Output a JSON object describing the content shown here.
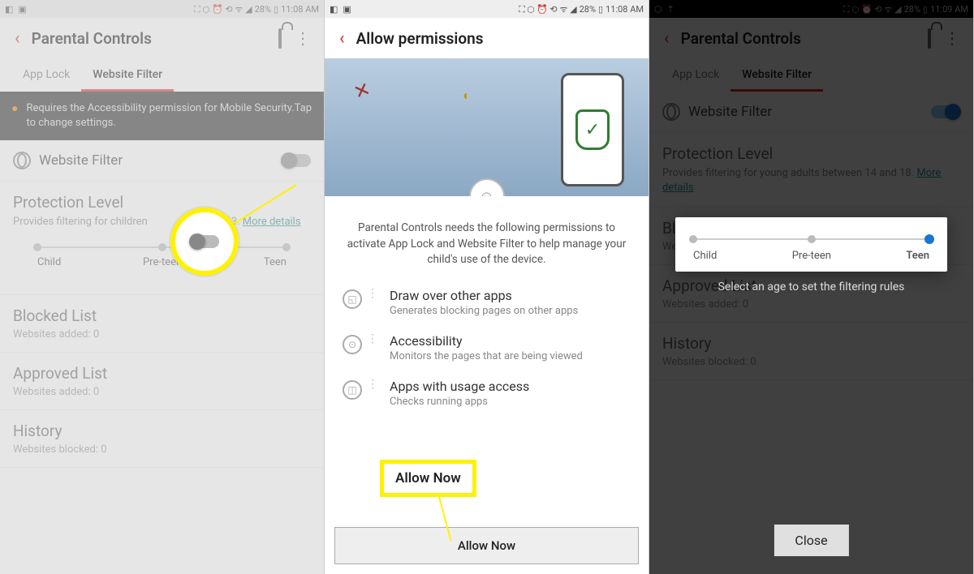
{
  "status": {
    "battery": "28%",
    "time1": "11:08 AM",
    "time2": "11:08 AM",
    "time3": "11:09 AM"
  },
  "s1": {
    "title": "Parental Controls",
    "tabs": {
      "appLock": "App Lock",
      "websiteFilter": "Website Filter"
    },
    "banner": "Requires the Accessibility permission for Mobile Security.Tap to change settings.",
    "websiteFilterLabel": "Website Filter",
    "protection": {
      "title": "Protection Level",
      "desc_a": "Provides filtering for children",
      "desc_b": "and 13.",
      "more": "More details"
    },
    "levels": {
      "child": "Child",
      "preteen": "Pre-teen",
      "teen": "Teen"
    },
    "blocked": {
      "title": "Blocked List",
      "sub": "Websites added: 0"
    },
    "approved": {
      "title": "Approved List",
      "sub": "Websites added: 0"
    },
    "history": {
      "title": "History",
      "sub": "Websites blocked: 0"
    }
  },
  "s2": {
    "title": "Allow permissions",
    "desc": "Parental Controls needs the following permissions to activate App Lock and Website Filter to help manage your child's use of the device.",
    "perms": [
      {
        "t": "Draw over other apps",
        "d": "Generates blocking pages on other apps"
      },
      {
        "t": "Accessibility",
        "d": "Monitors the pages that are being viewed"
      },
      {
        "t": "Apps with usage access",
        "d": "Checks running apps"
      }
    ],
    "allow": "Allow Now",
    "calloutAllow": "Allow Now"
  },
  "s3": {
    "title": "Parental Controls",
    "tabs": {
      "appLock": "App Lock",
      "websiteFilter": "Website Filter"
    },
    "websiteFilterLabel": "Website Filter",
    "protection": {
      "title": "Protection Level",
      "desc": "Provides filtering for young adults between 14 and 18.",
      "more": "More details"
    },
    "levels": {
      "child": "Child",
      "preteen": "Pre-teen",
      "teen": "Teen"
    },
    "blocked": {
      "title": "Blocked List",
      "sub": "Websites added: 0"
    },
    "approved": {
      "title": "Approved List",
      "sub": "Websites added: 0"
    },
    "history": {
      "title": "History",
      "sub": "Websites blocked: 0"
    },
    "hint": "Select an age to set the filtering rules",
    "close": "Close"
  }
}
